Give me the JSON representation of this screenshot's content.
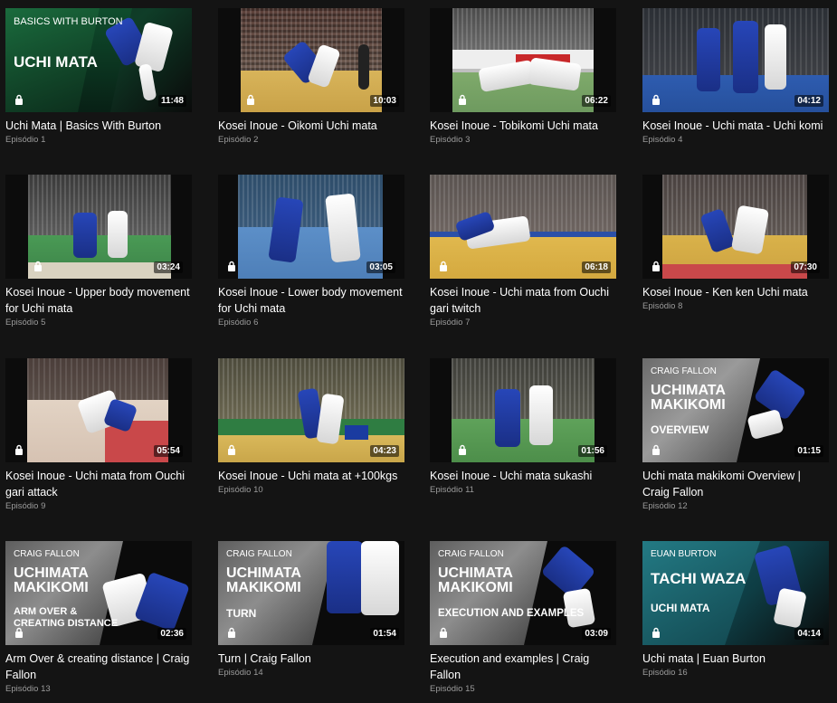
{
  "episodes": [
    {
      "title": "Uchi Mata | Basics With Burton",
      "episode": "Episódio 1",
      "duration": "11:48",
      "promo_top": "BASICS WITH BURTON",
      "promo_big": "UCHI MATA"
    },
    {
      "title": "Kosei Inoue - Oikomi Uchi mata",
      "episode": "Episódio 2",
      "duration": "10:03"
    },
    {
      "title": "Kosei Inoue - Tobikomi Uchi mata",
      "episode": "Episódio 3",
      "duration": "06:22"
    },
    {
      "title": "Kosei Inoue - Uchi mata - Uchi komi",
      "episode": "Episódio 4",
      "duration": "04:12"
    },
    {
      "title": "Kosei Inoue - Upper body movement for Uchi mata",
      "episode": "Episódio 5",
      "duration": "03:24"
    },
    {
      "title": "Kosei Inoue - Lower body movement for Uchi mata",
      "episode": "Episódio 6",
      "duration": "03:05"
    },
    {
      "title": "Kosei Inoue - Uchi mata from Ouchi gari twitch",
      "episode": "Episódio 7",
      "duration": "06:18"
    },
    {
      "title": "Kosei Inoue - Ken ken Uchi mata",
      "episode": "Episódio 8",
      "duration": "07:30"
    },
    {
      "title": "Kosei Inoue - Uchi mata from Ouchi gari attack",
      "episode": "Episódio 9",
      "duration": "05:54"
    },
    {
      "title": "Kosei Inoue - Uchi mata at +100kgs",
      "episode": "Episódio 10",
      "duration": "04:23"
    },
    {
      "title": "Kosei Inoue - Uchi mata sukashi",
      "episode": "Episódio 11",
      "duration": "01:56"
    },
    {
      "title": "Uchi mata makikomi Overview | Craig Fallon",
      "episode": "Episódio 12",
      "duration": "01:15",
      "promo_top": "CRAIG FALLON",
      "promo_big": "UCHIMATA\nMAKIKOMI",
      "promo_sub": "OVERVIEW"
    },
    {
      "title": "Arm Over & creating distance | Craig Fallon",
      "episode": "Episódio 13",
      "duration": "02:36",
      "promo_top": "CRAIG FALLON",
      "promo_big": "UCHIMATA\nMAKIKOMI",
      "promo_sub": "ARM OVER &\nCREATING DISTANCE"
    },
    {
      "title": "Turn | Craig Fallon",
      "episode": "Episódio 14",
      "duration": "01:54",
      "promo_top": "CRAIG FALLON",
      "promo_big": "UCHIMATA\nMAKIKOMI",
      "promo_sub": "TURN"
    },
    {
      "title": "Execution and examples | Craig Fallon",
      "episode": "Episódio 15",
      "duration": "03:09",
      "promo_top": "CRAIG FALLON",
      "promo_big": "UCHIMATA\nMAKIKOMI",
      "promo_sub": "EXECUTION AND EXAMPLES"
    },
    {
      "title": "Uchi mata | Euan Burton",
      "episode": "Episódio 16",
      "duration": "04:14",
      "promo_top": "EUAN BURTON",
      "promo_big": "TACHI WAZA",
      "promo_sub": "UCHI MATA"
    }
  ],
  "colors": {
    "background": "#141414",
    "episode_text": "#9b9b9b",
    "mat_green": "#3e8f52",
    "mat_red": "#c9484a",
    "mat_yellow": "#d9b24a",
    "mat_blue": "#2b5bbf",
    "promo_teal": "#1e6e78"
  }
}
